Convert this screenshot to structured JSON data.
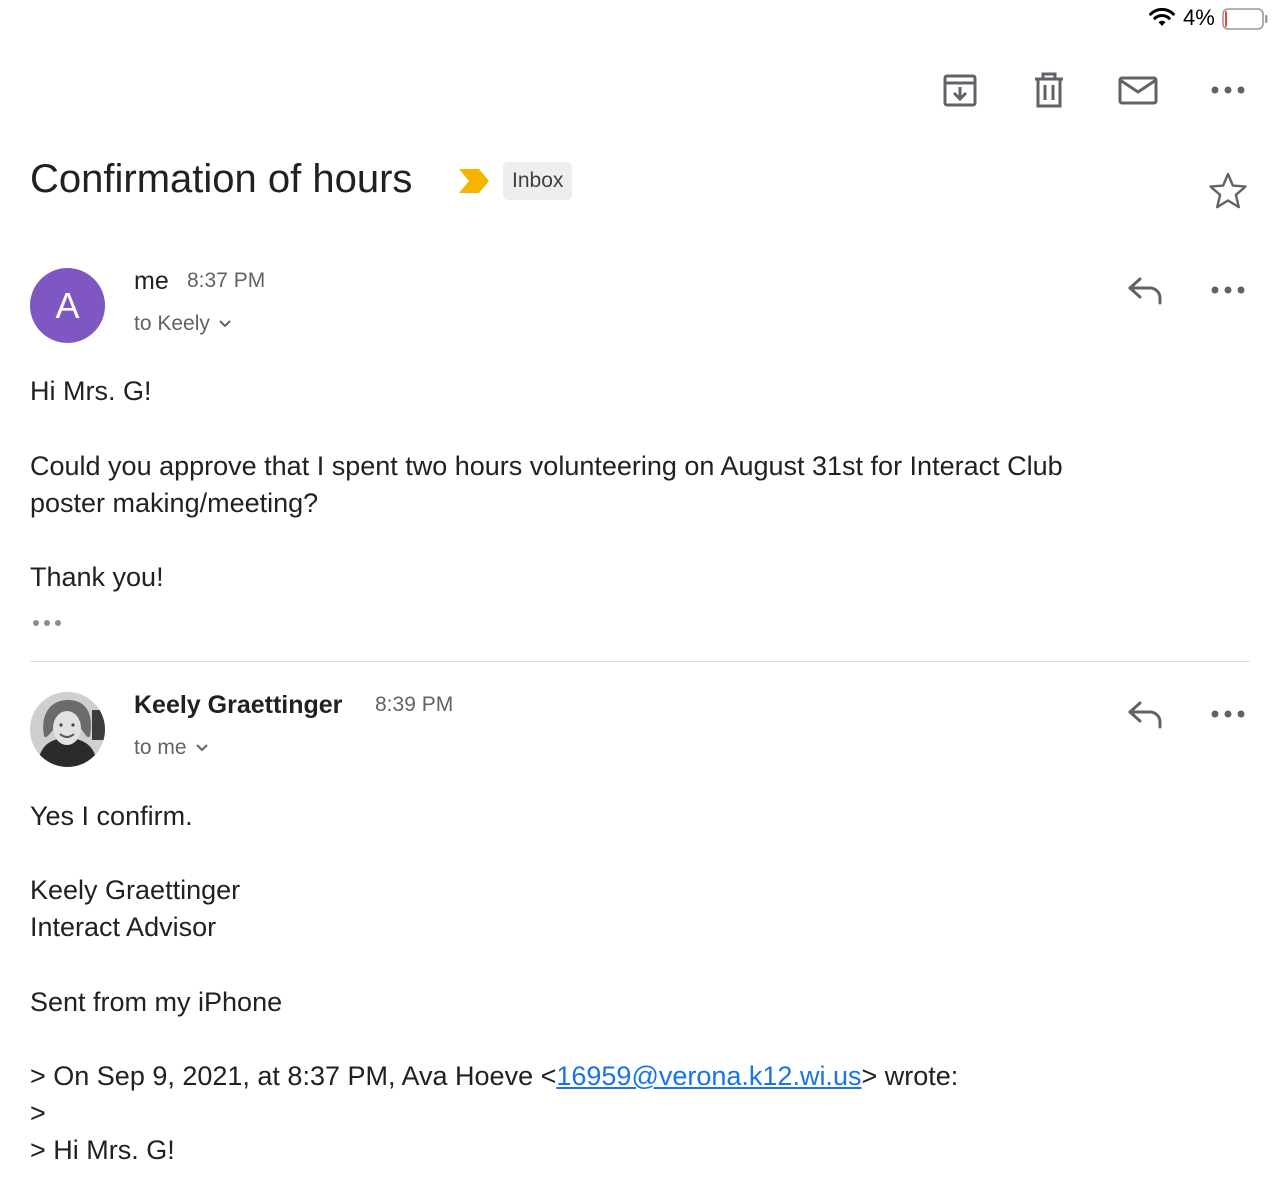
{
  "status_bar": {
    "battery_percent": "4%",
    "battery_level": 0.04,
    "battery_color": "#e8452c"
  },
  "toolbar": {
    "archive_icon": "archive-icon",
    "delete_icon": "trash-icon",
    "mail_icon": "mail-icon",
    "more_icon": "more-horizontal-icon"
  },
  "thread": {
    "subject": "Confirmation of hours",
    "importance_color": "#f4b400",
    "label": "Inbox"
  },
  "messages": [
    {
      "avatar_letter": "A",
      "avatar_color": "#7e57c2",
      "sender": "me",
      "time": "8:37 PM",
      "recipient": "to Keely",
      "body": {
        "greeting": "Hi Mrs. G!",
        "line1": "Could you approve that I spent two hours volunteering on August 31st for Interact Club",
        "line2": "poster making/meeting?",
        "closing": "Thank you!"
      }
    },
    {
      "sender": "Keely Graettinger",
      "time": "8:39 PM",
      "recipient": "to me",
      "body": {
        "line1": "Yes I confirm.",
        "sig_name": "Keely Graettinger",
        "sig_title": "Interact Advisor",
        "sent_from": "Sent from my iPhone",
        "quote_prefix": "> On Sep 9, 2021, at 8:37 PM, Ava Hoeve <",
        "quote_email": "16959@verona.k12.wi.us",
        "quote_suffix": "> wrote:",
        "quote_line2": ">",
        "quote_line3": "> Hi Mrs. G!"
      }
    }
  ]
}
